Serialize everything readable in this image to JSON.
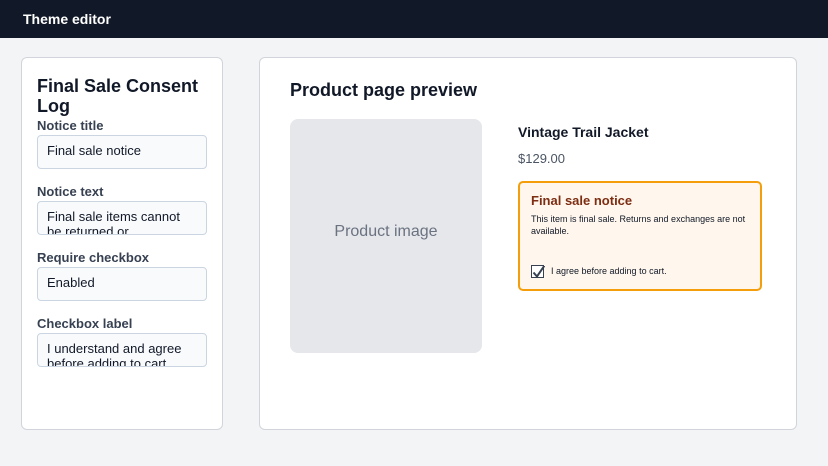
{
  "app": {
    "title": "Theme editor"
  },
  "settings": {
    "title": "Final Sale Consent Log",
    "fields": [
      {
        "label": "Notice title",
        "value": "Final sale notice"
      },
      {
        "label": "Notice text",
        "value": "Final sale items cannot be returned or exchanged."
      },
      {
        "label": "Require checkbox",
        "value": "Enabled"
      },
      {
        "label": "Checkbox label",
        "value": "I understand and agree before adding to cart."
      }
    ]
  },
  "preview": {
    "title": "Product page preview",
    "image_label": "Product image",
    "product_name": "Vintage Trail Jacket",
    "price": "$129.00",
    "notice": {
      "title": "Final sale notice",
      "text": "This item is final sale. Returns and exchanges are not available.",
      "checkbox_checked": true,
      "checkbox_label": "I agree before adding to cart."
    }
  },
  "colors": {
    "topbar": "#111827",
    "notice_border": "#f59e0b",
    "notice_background": "#fff7ed"
  }
}
